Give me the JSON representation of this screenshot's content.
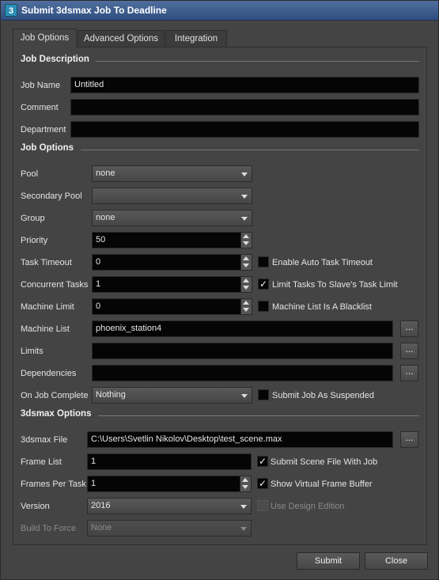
{
  "window": {
    "title": "Submit 3dsmax Job To Deadline",
    "icon_letter": "3",
    "close_glyph": "✕"
  },
  "tabs": [
    {
      "label": "Job Options",
      "active": true
    },
    {
      "label": "Advanced Options",
      "active": false
    },
    {
      "label": "Integration",
      "active": false
    }
  ],
  "job_description": {
    "heading": "Job Description",
    "job_name_label": "Job Name",
    "job_name_value": "Untitled",
    "comment_label": "Comment",
    "comment_value": "",
    "department_label": "Department",
    "department_value": ""
  },
  "job_options": {
    "heading": "Job Options",
    "pool_label": "Pool",
    "pool_value": "none",
    "secondary_pool_label": "Secondary Pool",
    "secondary_pool_value": "",
    "group_label": "Group",
    "group_value": "none",
    "priority_label": "Priority",
    "priority_value": "50",
    "task_timeout_label": "Task Timeout",
    "task_timeout_value": "0",
    "auto_task_timeout_label": "Enable Auto Task Timeout",
    "auto_task_timeout_checked": false,
    "concurrent_tasks_label": "Concurrent Tasks",
    "concurrent_tasks_value": "1",
    "limit_tasks_label": "Limit Tasks To Slave's Task Limit",
    "limit_tasks_checked": true,
    "machine_limit_label": "Machine Limit",
    "machine_limit_value": "0",
    "machine_blacklist_label": "Machine List Is A Blacklist",
    "machine_blacklist_checked": false,
    "machine_list_label": "Machine List",
    "machine_list_value": "phoenix_station4",
    "limits_label": "Limits",
    "limits_value": "",
    "dependencies_label": "Dependencies",
    "dependencies_value": "",
    "on_job_complete_label": "On Job Complete",
    "on_job_complete_value": "Nothing",
    "submit_suspended_label": "Submit Job As Suspended",
    "submit_suspended_checked": false,
    "browse_label": "..."
  },
  "max_options": {
    "heading": "3dsmax Options",
    "file_label": "3dsmax File",
    "file_value": "C:\\Users\\Svetlin Nikolov\\Desktop\\test_scene.max",
    "frame_list_label": "Frame List",
    "frame_list_value": "1",
    "submit_scene_label": "Submit Scene File With Job",
    "submit_scene_checked": true,
    "frames_per_task_label": "Frames Per Task",
    "frames_per_task_value": "1",
    "show_vfb_label": "Show Virtual Frame Buffer",
    "show_vfb_checked": true,
    "version_label": "Version",
    "version_value": "2016",
    "design_edition_label": "Use Design Edition",
    "design_edition_checked": false,
    "build_label": "Build To Force",
    "build_value": "None"
  },
  "footer": {
    "submit_label": "Submit",
    "close_label": "Close"
  },
  "icons": {
    "checkmark": "✓"
  }
}
